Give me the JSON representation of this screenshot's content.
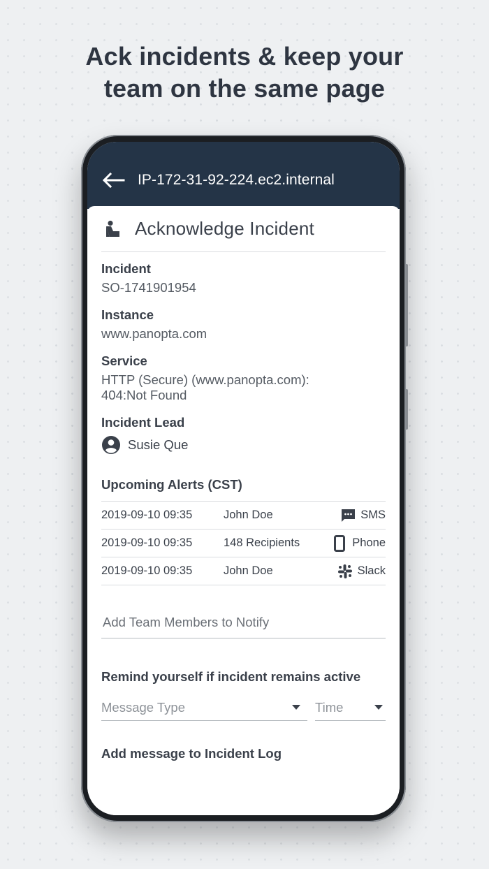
{
  "headline": {
    "line1": "Ack incidents & keep your",
    "line2": "team on the same page"
  },
  "appbar": {
    "back_icon": "arrow-left-icon",
    "title": "IP-172-31-92-224.ec2.internal"
  },
  "card": {
    "icon": "acknowledge-person-icon",
    "title": "Acknowledge Incident"
  },
  "fields": {
    "incident": {
      "label": "Incident",
      "value": "SO-1741901954"
    },
    "instance": {
      "label": "Instance",
      "value": "www.panopta.com"
    },
    "service": {
      "label": "Service",
      "value_line1": "HTTP (Secure) (www.panopta.com):",
      "value_line2": "404:Not Found"
    },
    "lead": {
      "label": "Incident Lead",
      "icon": "account-circle-icon",
      "name": "Susie Que"
    }
  },
  "alerts": {
    "title": "Upcoming Alerts (CST)",
    "rows": [
      {
        "date": "2019-09-10 09:35",
        "who": "John Doe",
        "channel": "SMS",
        "icon": "sms-icon"
      },
      {
        "date": "2019-09-10 09:35",
        "who": "148 Recipients",
        "channel": "Phone",
        "icon": "phone-icon"
      },
      {
        "date": "2019-09-10 09:35",
        "who": "John Doe",
        "channel": "Slack",
        "icon": "slack-icon"
      }
    ]
  },
  "notify": {
    "placeholder": "Add Team Members to Notify"
  },
  "remind": {
    "title": "Remind yourself if incident remains active",
    "message_type_placeholder": "Message Type",
    "time_placeholder": "Time"
  },
  "log": {
    "title": "Add message to Incident Log"
  },
  "colors": {
    "appbar": "#243447",
    "text": "#3a404a",
    "background": "#eef0f2"
  }
}
